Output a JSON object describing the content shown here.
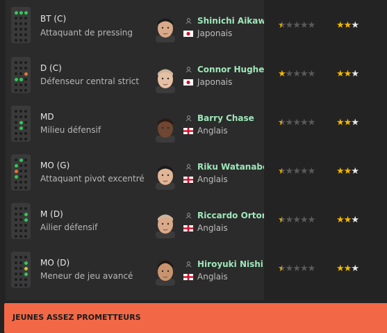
{
  "colors": {
    "accent": "#f26846",
    "name": "#9fe7ba",
    "star": "#f5b800",
    "star_empty": "#5a5a5a",
    "pos_green": "#2fcb57",
    "pos_orange": "#e07b2a",
    "pos_yellow": "#c9c93b"
  },
  "players": [
    {
      "position": "BT (C)",
      "role": "Attaquant de pressing",
      "name": "Shinichi Aikawa",
      "nationality": "Japonais",
      "flag": "japan",
      "ability_stars": 0.5,
      "potential_stars": 2.5
    },
    {
      "position": "D (C)",
      "role": "Défenseur central strict",
      "name": "Connor Hughes",
      "nationality": "Japonais",
      "flag": "japan",
      "ability_stars": 1,
      "potential_stars": 2.5
    },
    {
      "position": "MD",
      "role": "Milieu défensif",
      "name": "Barry Chase",
      "nationality": "Anglais",
      "flag": "england",
      "ability_stars": 0.5,
      "potential_stars": 2.5
    },
    {
      "position": "MO (G)",
      "role": "Attaquant pivot excentré",
      "name": "Riku Watanabe",
      "nationality": "Anglais",
      "flag": "england",
      "ability_stars": 0.5,
      "potential_stars": 2.5
    },
    {
      "position": "M (D)",
      "role": "Ailier défensif",
      "name": "Riccardo Orton",
      "nationality": "Anglais",
      "flag": "england",
      "ability_stars": 0.5,
      "potential_stars": 2.5
    },
    {
      "position": "MO (D)",
      "role": "Meneur de jeu avancé",
      "name": "Hiroyuki Nishi",
      "nationality": "Anglais",
      "flag": "england",
      "ability_stars": 0.5,
      "potential_stars": 2.5
    }
  ],
  "footer": {
    "label": "JEUNES ASSEZ PROMETTEURS"
  }
}
